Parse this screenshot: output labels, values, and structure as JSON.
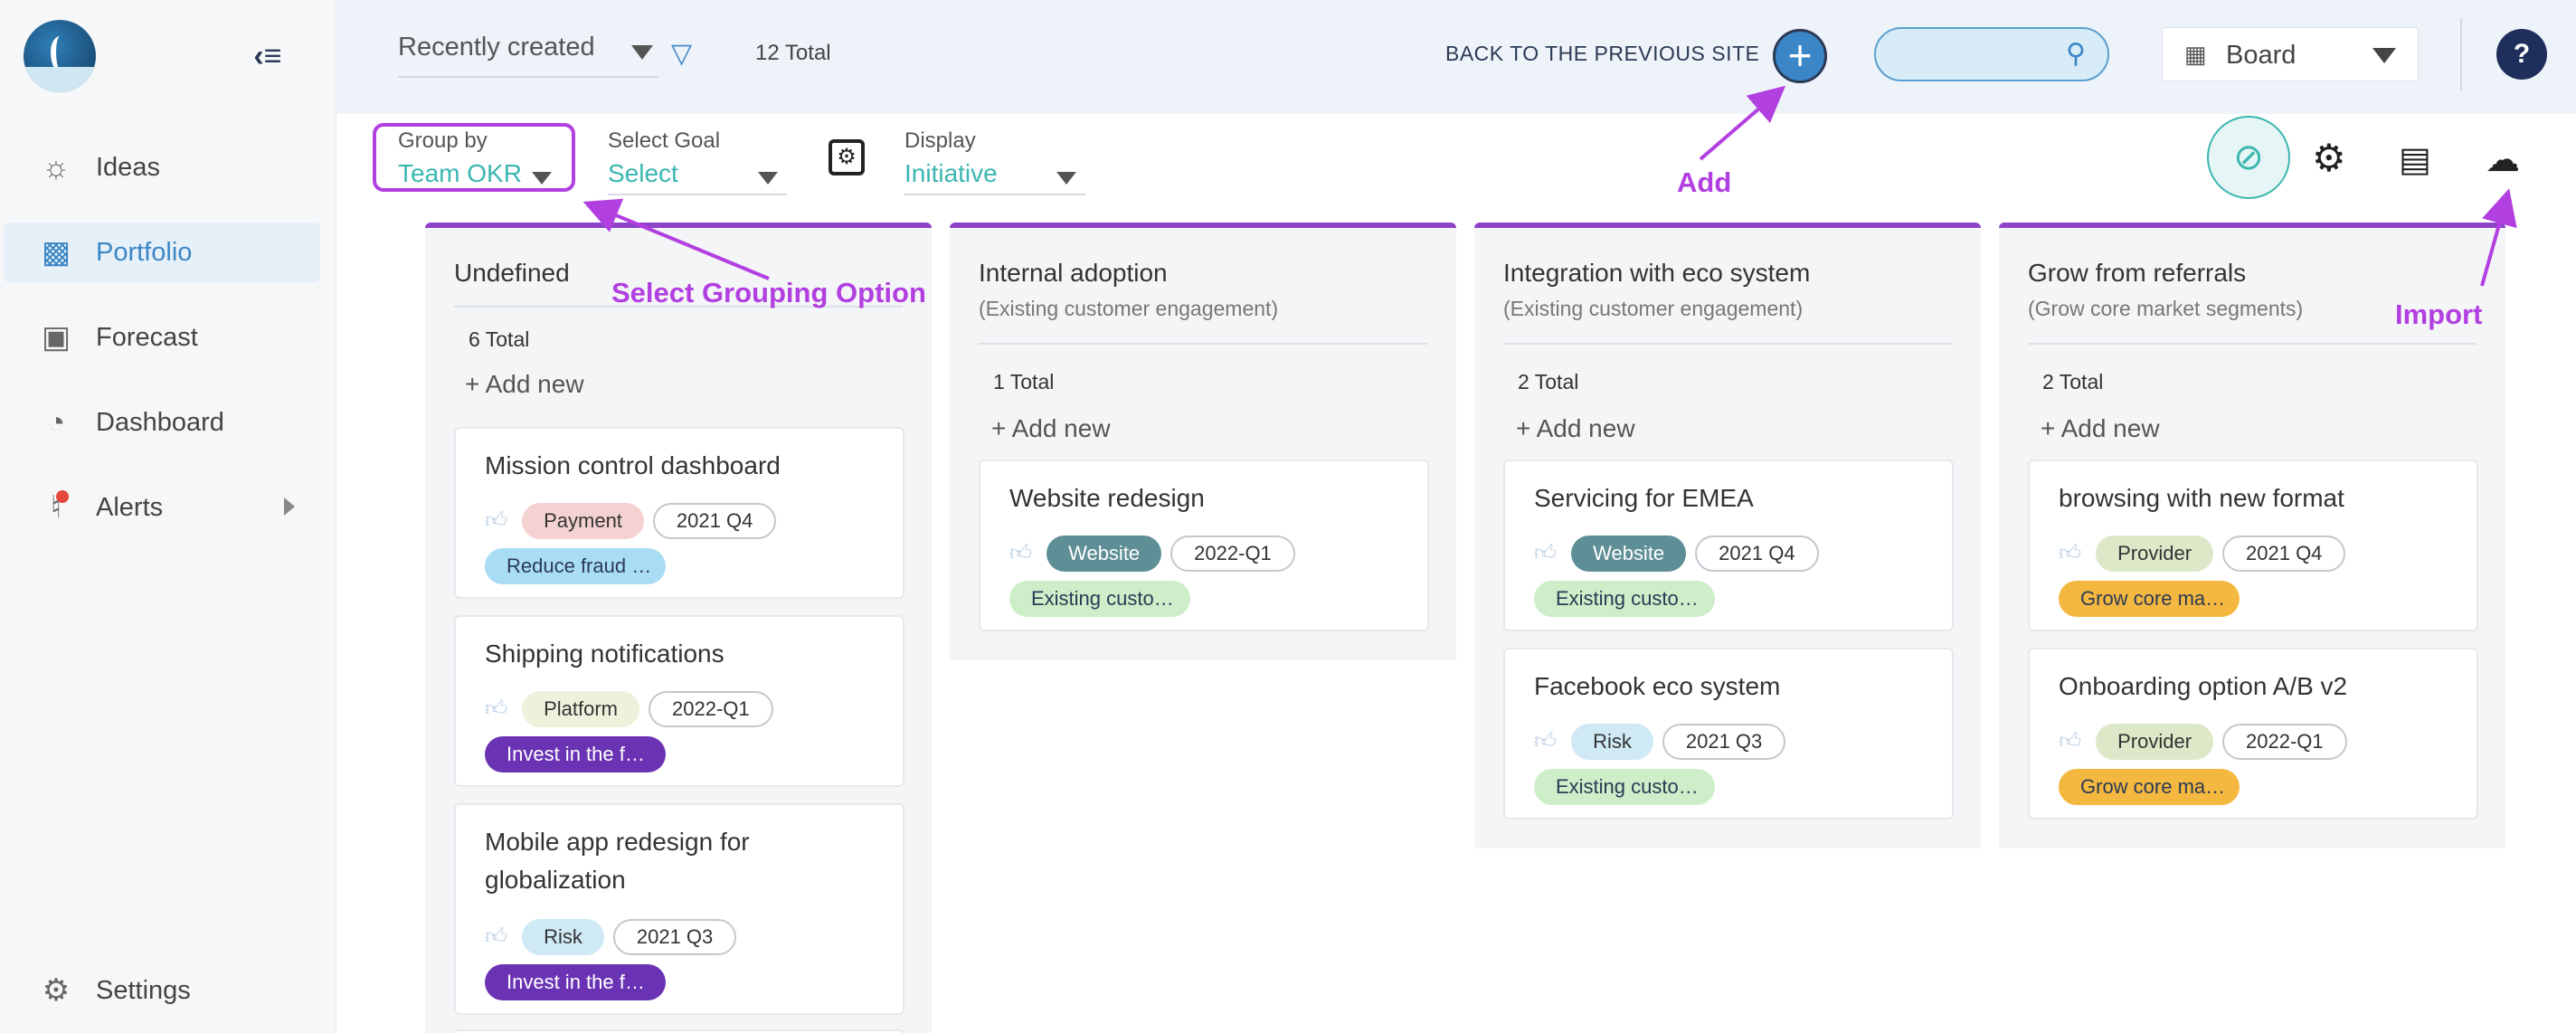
{
  "sidebar": {
    "items": [
      {
        "label": "Ideas",
        "icon": "bulb-icon"
      },
      {
        "label": "Portfolio",
        "icon": "briefcase-icon"
      },
      {
        "label": "Forecast",
        "icon": "forecast-icon"
      },
      {
        "label": "Dashboard",
        "icon": "pie-icon"
      },
      {
        "label": "Alerts",
        "icon": "bell-icon"
      }
    ],
    "settings_label": "Settings"
  },
  "header": {
    "sort_value": "Recently created",
    "total": "12 Total",
    "back_link": "BACK TO THE PREVIOUS SITE",
    "add_label": "+",
    "search_placeholder": "",
    "view_value": "Board",
    "help_label": "?"
  },
  "toolbar": {
    "group_by_label": "Group by",
    "group_by_value": "Team OKR",
    "goal_label": "Select Goal",
    "goal_value": "Select",
    "display_label": "Display",
    "display_value": "Initiative"
  },
  "columns": [
    {
      "title": "Undefined",
      "subtitle": "",
      "total": "6 Total",
      "add_new": "+ Add new",
      "cards": [
        {
          "title": "Mission control dashboard",
          "category": "Payment",
          "quarter": "2021 Q4",
          "goal": "Reduce fraud …",
          "category_color": "#f5d2d2",
          "goal_color": "#a9dcf5",
          "goal_text_color": "#2b3a55"
        },
        {
          "title": "Shipping notifications",
          "category": "Platform",
          "quarter": "2022-Q1",
          "goal": "Invest in the f…",
          "category_color": "#eef2dc",
          "goal_color": "#6a33b4",
          "goal_text_color": "#ffffff"
        },
        {
          "title": "Mobile app redesign for globalization",
          "category": "Risk",
          "quarter": "2021 Q3",
          "goal": "Invest in the f…",
          "category_color": "#cfe9f5",
          "goal_color": "#6a33b4",
          "goal_text_color": "#ffffff"
        }
      ]
    },
    {
      "title": "Internal adoption",
      "subtitle": "(Existing customer engagement)",
      "total": "1 Total",
      "add_new": "+ Add new",
      "cards": [
        {
          "title": "Website redesign",
          "category": "Website",
          "quarter": "2022-Q1",
          "goal": "Existing custo…",
          "category_color": "#5f8f96",
          "goal_color": "#cdeec8",
          "goal_text_color": "#2b3a55"
        }
      ]
    },
    {
      "title": "Integration with eco system",
      "subtitle": "(Existing customer engagement)",
      "total": "2 Total",
      "add_new": "+ Add new",
      "cards": [
        {
          "title": "Servicing for EMEA",
          "category": "Website",
          "quarter": "2021 Q4",
          "goal": "Existing custo…",
          "category_color": "#5f8f96",
          "goal_color": "#cdeec8",
          "goal_text_color": "#2b3a55"
        },
        {
          "title": "Facebook eco system",
          "category": "Risk",
          "quarter": "2021 Q3",
          "goal": "Existing custo…",
          "category_color": "#cfe9f5",
          "goal_color": "#cdeec8",
          "goal_text_color": "#2b3a55"
        }
      ]
    },
    {
      "title": "Grow from referrals",
      "subtitle": "(Grow core market segments)",
      "total": "2 Total",
      "add_new": "+ Add new",
      "cards": [
        {
          "title": "browsing with new format",
          "category": "Provider",
          "quarter": "2021 Q4",
          "goal": "Grow core ma…",
          "category_color": "#dde8c8",
          "goal_color": "#f4b840",
          "goal_text_color": "#2b3a55"
        },
        {
          "title": "Onboarding option A/B v2",
          "category": "Provider",
          "quarter": "2022-Q1",
          "goal": "Grow core ma…",
          "category_color": "#dde8c8",
          "goal_color": "#f4b840",
          "goal_text_color": "#2b3a55"
        }
      ]
    }
  ],
  "annotations": {
    "add": "Add",
    "grouping": "Select Grouping Option",
    "import": "Import"
  },
  "colors": {
    "accent": "#3b86c6",
    "teal": "#3bb6b0",
    "annotation": "#b23fe0",
    "column_border": "#8e44c9"
  }
}
